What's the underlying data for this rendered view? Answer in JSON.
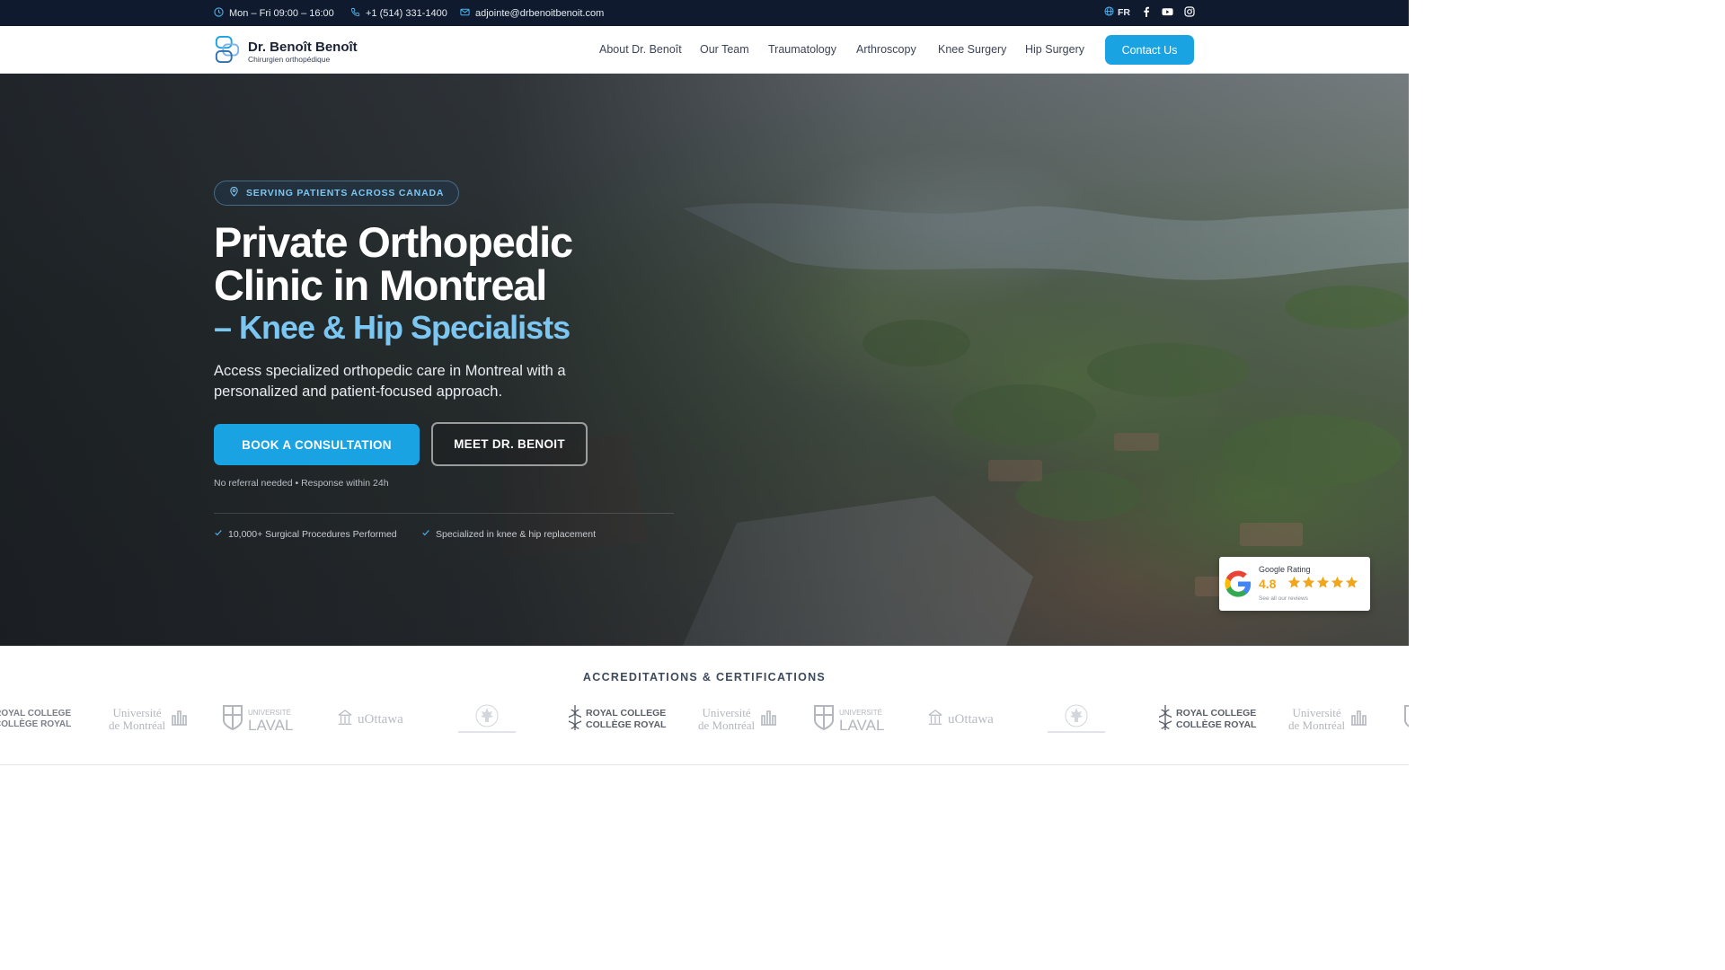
{
  "topbar": {
    "hours": "Mon – Fri 09:00 – 16:00",
    "phone": "+1 (514) 331-1400",
    "email": "adjointe@drbenoitbenoit.com",
    "language": "FR"
  },
  "brand": {
    "name": "Dr. Benoît Benoît",
    "tagline": "Chirurgien orthopédique",
    "accent": "#1aa3e3",
    "dark": "#0f1a2e"
  },
  "nav": {
    "items": [
      "About Dr. Benoît",
      "Our Team",
      "Traumatology",
      "Arthroscopy",
      "Knee Surgery",
      "Hip Surgery"
    ],
    "cta": "Contact Us"
  },
  "hero": {
    "badge": "SERVING PATIENTS ACROSS CANADA",
    "title_line1": "Private Orthopedic",
    "title_line2": "Clinic in Montreal",
    "title_line3": "– Knee & Hip Specialists",
    "lead": "Access specialized orthopedic care in Montreal with a personalized and patient-focused approach.",
    "primary_button": "BOOK A CONSULTATION",
    "secondary_button": "MEET DR. BENOIT",
    "note": "No referral needed • Response within 24h",
    "checks": [
      "10,000+ Surgical Procedures Performed",
      "Specialized in knee & hip replacement"
    ]
  },
  "rating": {
    "label": "Google Rating",
    "score": "4.8",
    "stars": 5,
    "link": "See all our reviews"
  },
  "accreditations": {
    "title": "ACCREDITATIONS & CERTIFICATIONS",
    "royal_college_top": "ROYAL COLLEGE",
    "royal_college_bottom": "COLLÈGE ROYAL",
    "udem_line1": "Université",
    "udem_line2": "de Montréal",
    "laval_line1": "UNIVERSITÉ",
    "laval_line2": "LAVAL",
    "uottawa": "uOttawa"
  }
}
